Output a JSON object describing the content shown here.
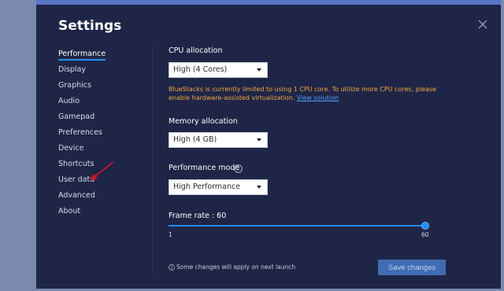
{
  "dialog": {
    "title": "Settings"
  },
  "nav": {
    "items": [
      {
        "label": "Performance"
      },
      {
        "label": "Display"
      },
      {
        "label": "Graphics"
      },
      {
        "label": "Audio"
      },
      {
        "label": "Gamepad"
      },
      {
        "label": "Preferences"
      },
      {
        "label": "Device"
      },
      {
        "label": "Shortcuts"
      },
      {
        "label": "User data"
      },
      {
        "label": "Advanced"
      },
      {
        "label": "About"
      }
    ],
    "active_index": 0
  },
  "cpu": {
    "label": "CPU allocation",
    "value": "High (4 Cores)",
    "warning": "BlueStacks is currently limited to using 1 CPU core. To utilize more CPU cores, please enable hardware-assisted virtualization.",
    "warning_link": "View solution"
  },
  "memory": {
    "label": "Memory allocation",
    "value": "High (4 GB)"
  },
  "performance_mode": {
    "label": "Performance mode",
    "value": "High Performance",
    "help_icon": "question-circle-icon"
  },
  "frame_rate": {
    "label": "Frame rate : 60",
    "min_label": "1",
    "max_label": "60",
    "value": 60,
    "min": 1,
    "max": 60
  },
  "footer": {
    "note": "Some changes will apply on next launch",
    "info_icon": "info-circle-icon",
    "save_label": "Save changes"
  },
  "colors": {
    "accent": "#1e8df2",
    "warning": "#f0a843",
    "dialog_bg": "#1f2546",
    "save_button": "#3f6cb2",
    "annotation_arrow": "#d0142a"
  }
}
